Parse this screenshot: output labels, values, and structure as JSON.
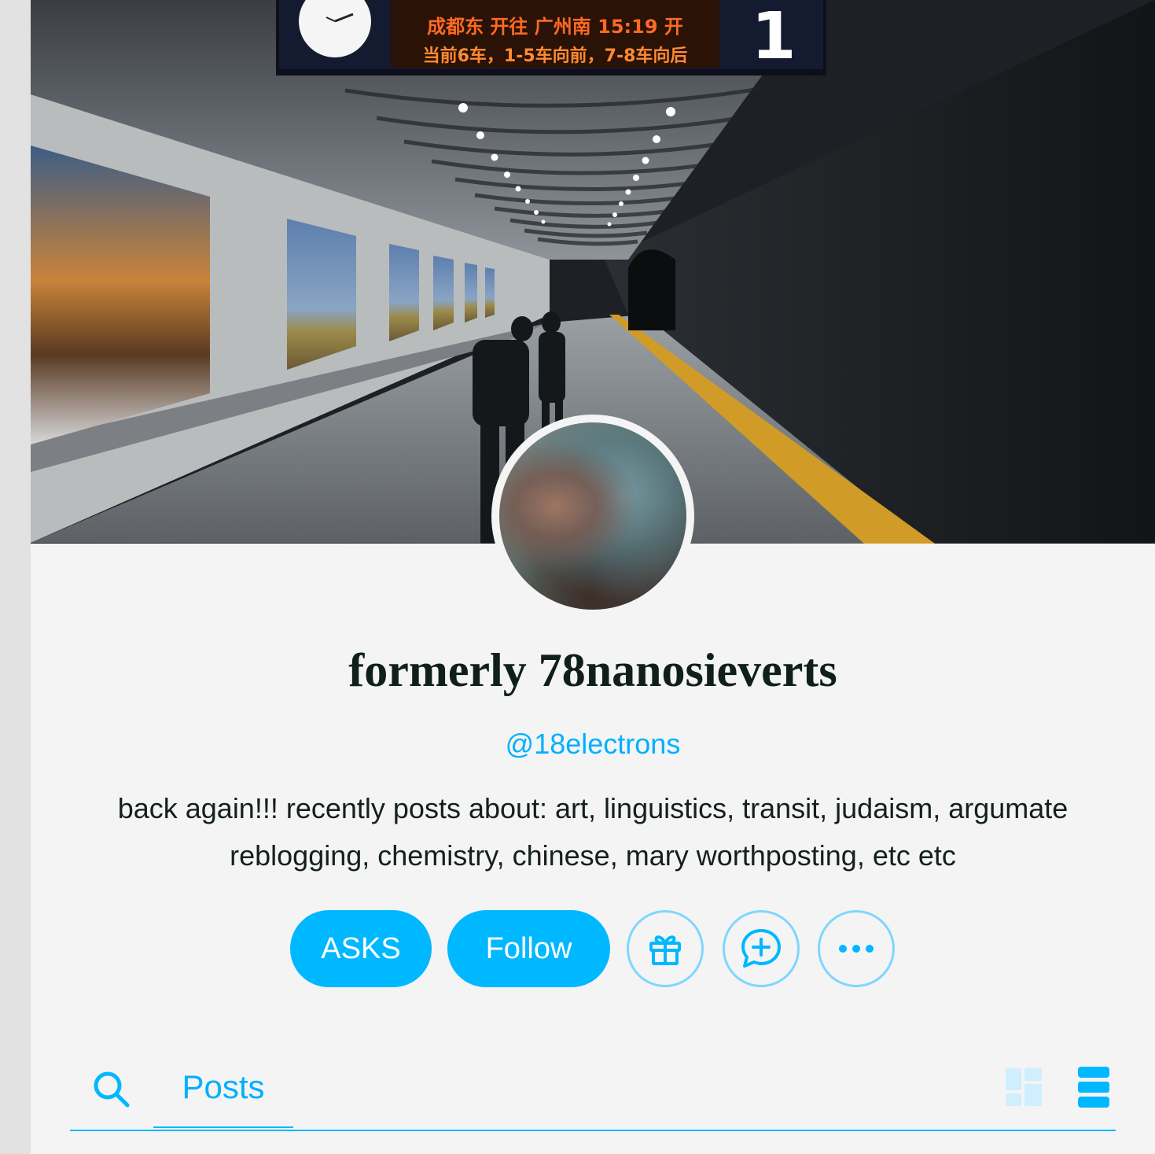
{
  "header_photo": {
    "sign": {
      "line1": "成都东  开往 广州南  15:19  开",
      "line2": "当前6车，1-5车向前，7-8车向后",
      "platform_number": "1"
    }
  },
  "blog": {
    "title": "formerly 78nanosieverts",
    "handle": "@18electrons",
    "description": "back again!!! recently posts about: art, linguistics, transit, judaism, argumate reblogging, chemistry, chinese, mary worthposting, etc etc"
  },
  "actions": {
    "asks_label": "ASKS",
    "follow_label": "Follow",
    "gift_icon": "gift-icon",
    "ask_icon": "message-plus-icon",
    "more_icon": "more-icon"
  },
  "tabs": {
    "search_icon": "search-icon",
    "posts_label": "Posts",
    "grid_view_icon": "grid-view-icon",
    "list_view_icon": "list-view-icon"
  },
  "colors": {
    "accent": "#00b8ff",
    "page_background": "#f4f4f4",
    "title_text": "#0f1f1c"
  }
}
